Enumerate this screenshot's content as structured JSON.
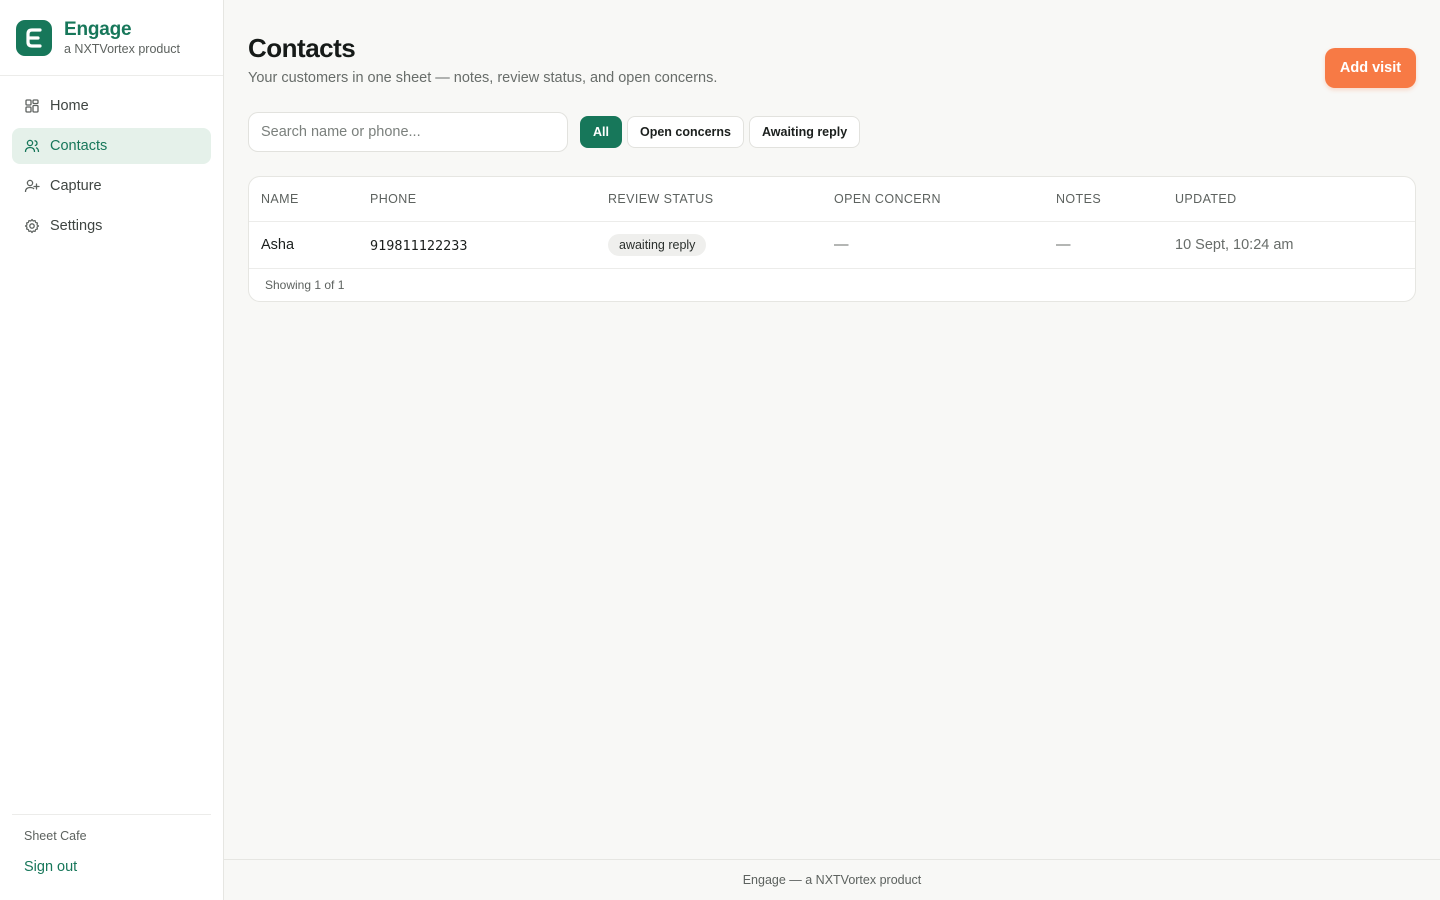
{
  "brand": {
    "name": "Engage",
    "tagline": "a NXTVortex product",
    "logo_letter": "E",
    "color": "#17775a"
  },
  "sidebar": {
    "items": [
      {
        "label": "Home",
        "icon": "grid-icon",
        "active": false
      },
      {
        "label": "Contacts",
        "icon": "users-icon",
        "active": true
      },
      {
        "label": "Capture",
        "icon": "user-plus-icon",
        "active": false
      },
      {
        "label": "Settings",
        "icon": "gear-icon",
        "active": false
      }
    ],
    "shop_name": "Sheet Cafe",
    "signout_label": "Sign out"
  },
  "header": {
    "title": "Contacts",
    "subtitle": "Your customers in one sheet — notes, review status, and open concerns.",
    "add_button": "Add visit",
    "add_button_color": "#f77a45"
  },
  "search": {
    "placeholder": "Search name or phone...",
    "value": ""
  },
  "filters": [
    {
      "label": "All",
      "active": true
    },
    {
      "label": "Open concerns",
      "active": false
    },
    {
      "label": "Awaiting reply",
      "active": false
    }
  ],
  "table": {
    "columns": [
      "NAME",
      "PHONE",
      "REVIEW STATUS",
      "OPEN CONCERN",
      "NOTES",
      "UPDATED"
    ],
    "rows": [
      {
        "name": "Asha",
        "phone": "919811122233",
        "review_status": "awaiting reply",
        "open_concern": "—",
        "notes": "—",
        "updated": "10 Sept, 10:24 am"
      }
    ],
    "footer": "Showing 1 of 1"
  },
  "footer": {
    "text": "Engage — a NXTVortex product"
  }
}
